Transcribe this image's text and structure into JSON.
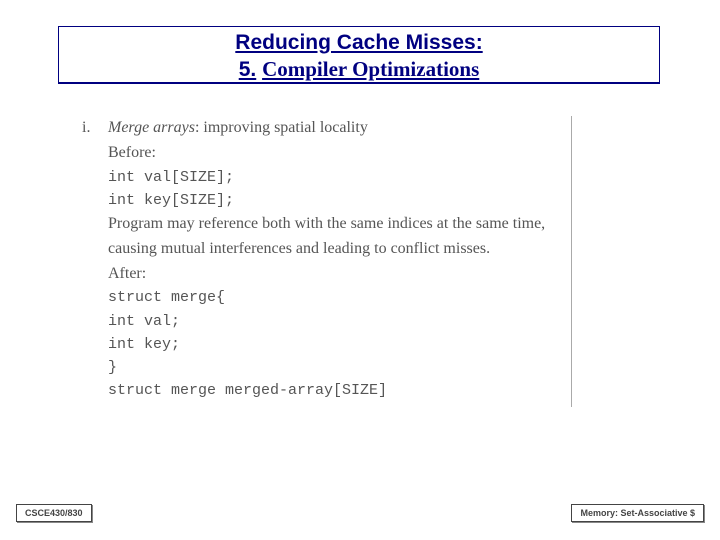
{
  "title": {
    "line1": "Reducing Cache Misses:",
    "number": "5.",
    "subtitle": "Compiler Optimizations"
  },
  "content": {
    "roman": "i.",
    "lead_italic": "Merge arrays",
    "lead_rest": ": improving spatial locality",
    "before_label": "Before:",
    "code_before_1": "int val[SIZE];",
    "code_before_2": "int key[SIZE];",
    "paragraph": "Program may reference both with the same indices at the same time, causing mutual interferences and leading to conflict misses.",
    "after_label": "After:",
    "code_after_1": "struct merge{",
    "code_after_2": "int val;",
    "code_after_3": "int key;",
    "code_after_4": "}",
    "code_after_5": "struct merge merged-array[SIZE]"
  },
  "footer": {
    "left": "CSCE430/830",
    "right": "Memory: Set-Associative $"
  }
}
